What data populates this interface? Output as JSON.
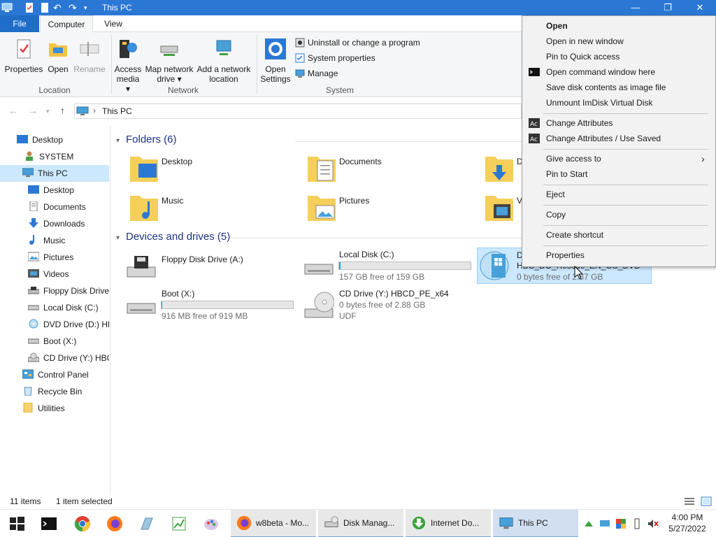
{
  "window": {
    "title": "This PC"
  },
  "tabs": [
    {
      "label": "File"
    },
    {
      "label": "Computer"
    },
    {
      "label": "View"
    }
  ],
  "ribbon": {
    "location": {
      "label": "Location",
      "properties": "Properties",
      "open": "Open",
      "rename": "Rename"
    },
    "network": {
      "label": "Network",
      "access_media_1": "Access",
      "access_media_2": "media ▾",
      "map_drive_1": "Map network",
      "map_drive_2": "drive ▾",
      "add_location_1": "Add a network",
      "add_location_2": "location"
    },
    "system": {
      "label": "System",
      "open_settings_1": "Open",
      "open_settings_2": "Settings",
      "uninstall": "Uninstall or change a program",
      "sys_props": "System properties",
      "manage": "Manage"
    }
  },
  "address": {
    "path": "This PC"
  },
  "nav": {
    "items": [
      {
        "label": "Desktop"
      },
      {
        "label": "SYSTEM"
      },
      {
        "label": "This PC"
      },
      {
        "label": "Desktop"
      },
      {
        "label": "Documents"
      },
      {
        "label": "Downloads"
      },
      {
        "label": "Music"
      },
      {
        "label": "Pictures"
      },
      {
        "label": "Videos"
      },
      {
        "label": "Floppy Disk Drive"
      },
      {
        "label": "Local Disk (C:)"
      },
      {
        "label": "DVD Drive (D:) HB"
      },
      {
        "label": "Boot (X:)"
      },
      {
        "label": "CD Drive (Y:) HBC"
      },
      {
        "label": "Control Panel"
      },
      {
        "label": "Recycle Bin"
      },
      {
        "label": "Utilities"
      }
    ]
  },
  "content": {
    "folders_header": "Folders (6)",
    "folders": [
      {
        "label": "Desktop"
      },
      {
        "label": "Documents"
      },
      {
        "label": "D"
      },
      {
        "label": "Music"
      },
      {
        "label": "Pictures"
      },
      {
        "label": "V"
      }
    ],
    "drives_header": "Devices and drives (5)",
    "drives": {
      "floppy": {
        "label": "Floppy Disk Drive (A:)"
      },
      "c": {
        "label": "Local Disk (C:)",
        "free": "157 GB free of 159 GB",
        "used_fraction": 0.013
      },
      "dvd": {
        "line1": "D",
        "line2": "HBC_DO_Rescue_EN_OS_DVD",
        "free": "0 bytes free of 2.87 GB"
      },
      "boot": {
        "label": "Boot (X:)",
        "free": "916 MB free of 919 MB",
        "used_fraction": 0.003
      },
      "cd": {
        "label": "CD Drive (Y:) HBCD_PE_x64",
        "free": "0 bytes free of 2.88 GB",
        "fs": "UDF"
      }
    }
  },
  "status": {
    "items": "11 items",
    "selected": "1 item selected"
  },
  "context_menu": {
    "items": [
      "Open",
      "Open in new window",
      "Pin to Quick access",
      "Open command window here",
      "Save disk contents as image file",
      "Unmount ImDisk Virtual Disk",
      "Change Attributes",
      "Change Attributes / Use Saved",
      "Give access to",
      "Pin to Start",
      "Eject",
      "Copy",
      "Create shortcut",
      "Properties"
    ]
  },
  "taskbar": {
    "buttons": [
      {
        "label": "w8beta - Mo..."
      },
      {
        "label": "Disk Manag..."
      },
      {
        "label": "Internet Do..."
      },
      {
        "label": "This PC"
      }
    ],
    "time": "4:00 PM",
    "date": "5/27/2022"
  },
  "colors": {
    "accent": "#2b78d4",
    "selection": "#cce8ff",
    "bar_fill": "#26a0da"
  }
}
